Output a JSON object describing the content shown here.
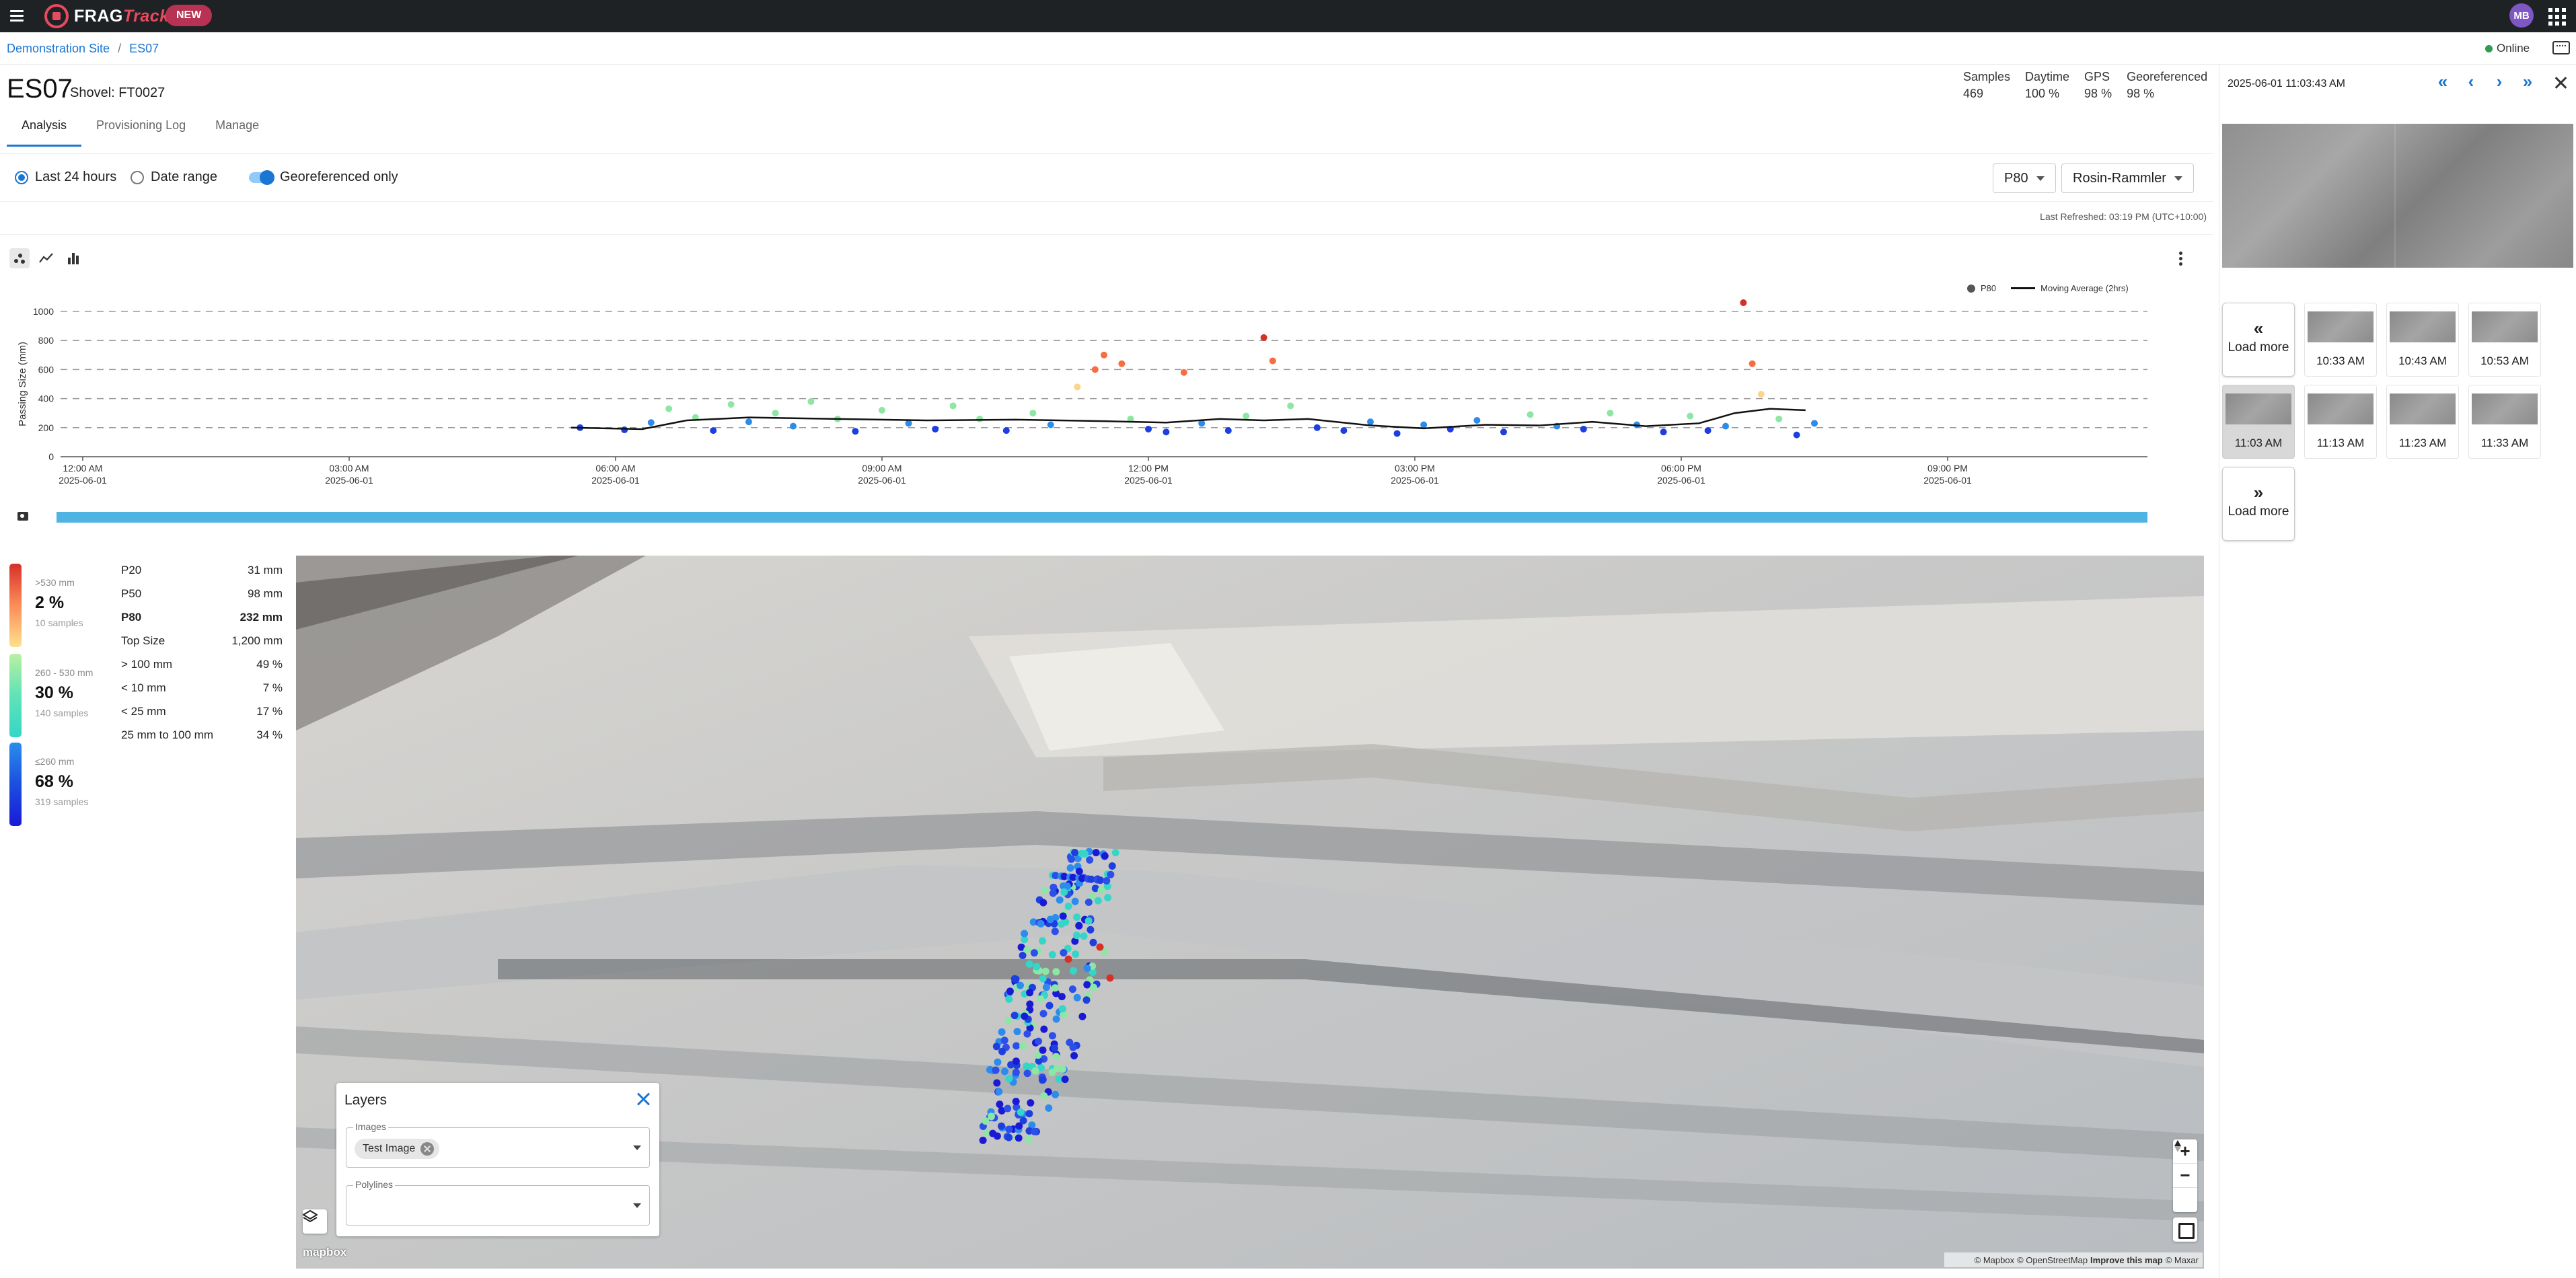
{
  "topbar": {
    "brand_frag": "FRAG",
    "brand_track": "Track",
    "new_badge": "NEW",
    "avatar_initials": "MB"
  },
  "breadcrumb": {
    "site": "Demonstration Site",
    "separator": "/",
    "current": "ES07"
  },
  "status": {
    "online": "Online",
    "online_color": "#2e9d4e"
  },
  "header": {
    "title": "ES07",
    "subtitle": "Shovel: FT0027",
    "stats": [
      {
        "label": "Samples",
        "value": "469"
      },
      {
        "label": "Daytime",
        "value": "100 %"
      },
      {
        "label": "GPS",
        "value": "98 %"
      },
      {
        "label": "Georeferenced",
        "value": "98 %"
      }
    ]
  },
  "tabs": [
    {
      "label": "Analysis",
      "active": true
    },
    {
      "label": "Provisioning Log",
      "active": false
    },
    {
      "label": "Manage",
      "active": false
    }
  ],
  "filters": {
    "last24": "Last 24 hours",
    "date_range": "Date range",
    "georef_only": "Georeferenced only",
    "metric_select": "P80",
    "model_select": "Rosin-Rammler"
  },
  "last_refreshed": "Last Refreshed: 03:19 PM (UTC+10:00)",
  "chart_tools": [
    "scatter-icon",
    "line-chart-icon",
    "bar-chart-icon"
  ],
  "chart_data": {
    "type": "scatter",
    "ylabel": "Passing Size (mm)",
    "ylim": [
      0,
      1000
    ],
    "y_ticks": [
      "0",
      "200",
      "400",
      "600",
      "800",
      "1000"
    ],
    "x_ticks": [
      {
        "time": "12:00 AM",
        "date": "2025-06-01"
      },
      {
        "time": "03:00 AM",
        "date": "2025-06-01"
      },
      {
        "time": "06:00 AM",
        "date": "2025-06-01"
      },
      {
        "time": "09:00 AM",
        "date": "2025-06-01"
      },
      {
        "time": "12:00 PM",
        "date": "2025-06-01"
      },
      {
        "time": "03:00 PM",
        "date": "2025-06-01"
      },
      {
        "time": "06:00 PM",
        "date": "2025-06-01"
      },
      {
        "time": "09:00 PM",
        "date": "2025-06-01"
      }
    ],
    "legend": [
      "P80",
      "Moving Average (2hrs)"
    ],
    "legend_position": "top-right",
    "grid": "dashed horizontal",
    "x_hours_range": [
      -0.25,
      23.25
    ],
    "series": [
      {
        "name": "P80",
        "points": [
          [
            5.6,
            200
          ],
          [
            6.1,
            185
          ],
          [
            6.4,
            235
          ],
          [
            6.6,
            330
          ],
          [
            6.9,
            270
          ],
          [
            7.1,
            180
          ],
          [
            7.3,
            360
          ],
          [
            7.5,
            240
          ],
          [
            7.8,
            300
          ],
          [
            8.0,
            210
          ],
          [
            8.2,
            380
          ],
          [
            8.5,
            260
          ],
          [
            8.7,
            175
          ],
          [
            9.0,
            320
          ],
          [
            9.3,
            230
          ],
          [
            9.6,
            190
          ],
          [
            9.8,
            350
          ],
          [
            10.1,
            260
          ],
          [
            10.4,
            180
          ],
          [
            10.7,
            300
          ],
          [
            10.9,
            220
          ],
          [
            11.2,
            480
          ],
          [
            11.4,
            600
          ],
          [
            11.5,
            700
          ],
          [
            11.7,
            640
          ],
          [
            11.8,
            260
          ],
          [
            12.0,
            190
          ],
          [
            12.2,
            170
          ],
          [
            12.4,
            580
          ],
          [
            12.6,
            230
          ],
          [
            12.9,
            180
          ],
          [
            13.1,
            280
          ],
          [
            13.3,
            820
          ],
          [
            13.4,
            660
          ],
          [
            13.6,
            350
          ],
          [
            13.9,
            200
          ],
          [
            14.2,
            180
          ],
          [
            14.5,
            240
          ],
          [
            14.8,
            160
          ],
          [
            15.1,
            220
          ],
          [
            15.4,
            190
          ],
          [
            15.7,
            250
          ],
          [
            16.0,
            170
          ],
          [
            16.3,
            290
          ],
          [
            16.6,
            210
          ],
          [
            16.9,
            190
          ],
          [
            17.2,
            300
          ],
          [
            17.5,
            220
          ],
          [
            17.8,
            170
          ],
          [
            18.1,
            280
          ],
          [
            18.3,
            180
          ],
          [
            18.5,
            210
          ],
          [
            18.7,
            1060
          ],
          [
            18.8,
            640
          ],
          [
            18.9,
            430
          ],
          [
            19.1,
            260
          ],
          [
            19.3,
            150
          ],
          [
            19.5,
            230
          ]
        ]
      },
      {
        "name": "Moving Average (2hrs)",
        "points": [
          [
            5.5,
            200
          ],
          [
            6.3,
            190
          ],
          [
            6.8,
            250
          ],
          [
            7.5,
            270
          ],
          [
            8.5,
            260
          ],
          [
            9.5,
            250
          ],
          [
            10.5,
            255
          ],
          [
            11.5,
            245
          ],
          [
            12.2,
            235
          ],
          [
            12.8,
            260
          ],
          [
            13.3,
            250
          ],
          [
            13.8,
            260
          ],
          [
            14.5,
            215
          ],
          [
            15.1,
            195
          ],
          [
            15.8,
            220
          ],
          [
            16.4,
            215
          ],
          [
            17.0,
            240
          ],
          [
            17.6,
            210
          ],
          [
            18.2,
            230
          ],
          [
            18.6,
            300
          ],
          [
            19.0,
            330
          ],
          [
            19.4,
            320
          ]
        ]
      }
    ]
  },
  "distribution": {
    "bands": [
      {
        "label": ">530 mm",
        "pct": "2 %",
        "samples": "10 samples",
        "color_top": "#d73027",
        "color_bottom": "#fee08b"
      },
      {
        "label": "260 - 530 mm",
        "pct": "30 %",
        "samples": "140 samples",
        "color_top": "#91e0a0",
        "color_bottom": "#35d6c7"
      },
      {
        "label": "≤260 mm",
        "pct": "68 %",
        "samples": "319 samples",
        "color_top": "#2b8cee",
        "color_bottom": "#1a1ad6"
      }
    ],
    "stats": [
      {
        "label": "P20",
        "value": "31 mm",
        "bold": false
      },
      {
        "label": "P50",
        "value": "98 mm",
        "bold": false
      },
      {
        "label": "P80",
        "value": "232 mm",
        "bold": true
      },
      {
        "label": "Top Size",
        "value": "1,200 mm",
        "bold": false
      },
      {
        "label": "> 100 mm",
        "value": "49 %",
        "bold": false
      },
      {
        "label": "< 10 mm",
        "value": "7 %",
        "bold": false
      },
      {
        "label": "< 25 mm",
        "value": "17 %",
        "bold": false
      },
      {
        "label": "25 mm to 100 mm",
        "value": "34 %",
        "bold": false
      }
    ]
  },
  "map": {
    "layers_title": "Layers",
    "images_label": "Images",
    "images_chip": "Test Image",
    "polylines_label": "Polylines",
    "logo": "mapbox",
    "zoom_in": "+",
    "zoom_out": "−",
    "attribution": [
      {
        "text": "© Mapbox",
        "bold": false
      },
      {
        "text": "© OpenStreetMap",
        "bold": false
      },
      {
        "text": "Improve this map",
        "bold": true
      },
      {
        "text": "© Maxar",
        "bold": false
      }
    ]
  },
  "right_panel": {
    "timestamp": "2025-06-01 11:03:43 AM",
    "nav": [
      "«",
      "‹",
      "›",
      "»"
    ],
    "load_more": "Load more",
    "load_more_top_arrow": "«",
    "load_more_bottom_arrow": "»",
    "thumbnails": [
      {
        "time": "10:33 AM",
        "selected": false
      },
      {
        "time": "10:43 AM",
        "selected": false
      },
      {
        "time": "10:53 AM",
        "selected": false
      },
      {
        "time": "11:03 AM",
        "selected": true
      },
      {
        "time": "11:13 AM",
        "selected": false
      },
      {
        "time": "11:23 AM",
        "selected": false
      },
      {
        "time": "11:33 AM",
        "selected": false
      }
    ]
  }
}
